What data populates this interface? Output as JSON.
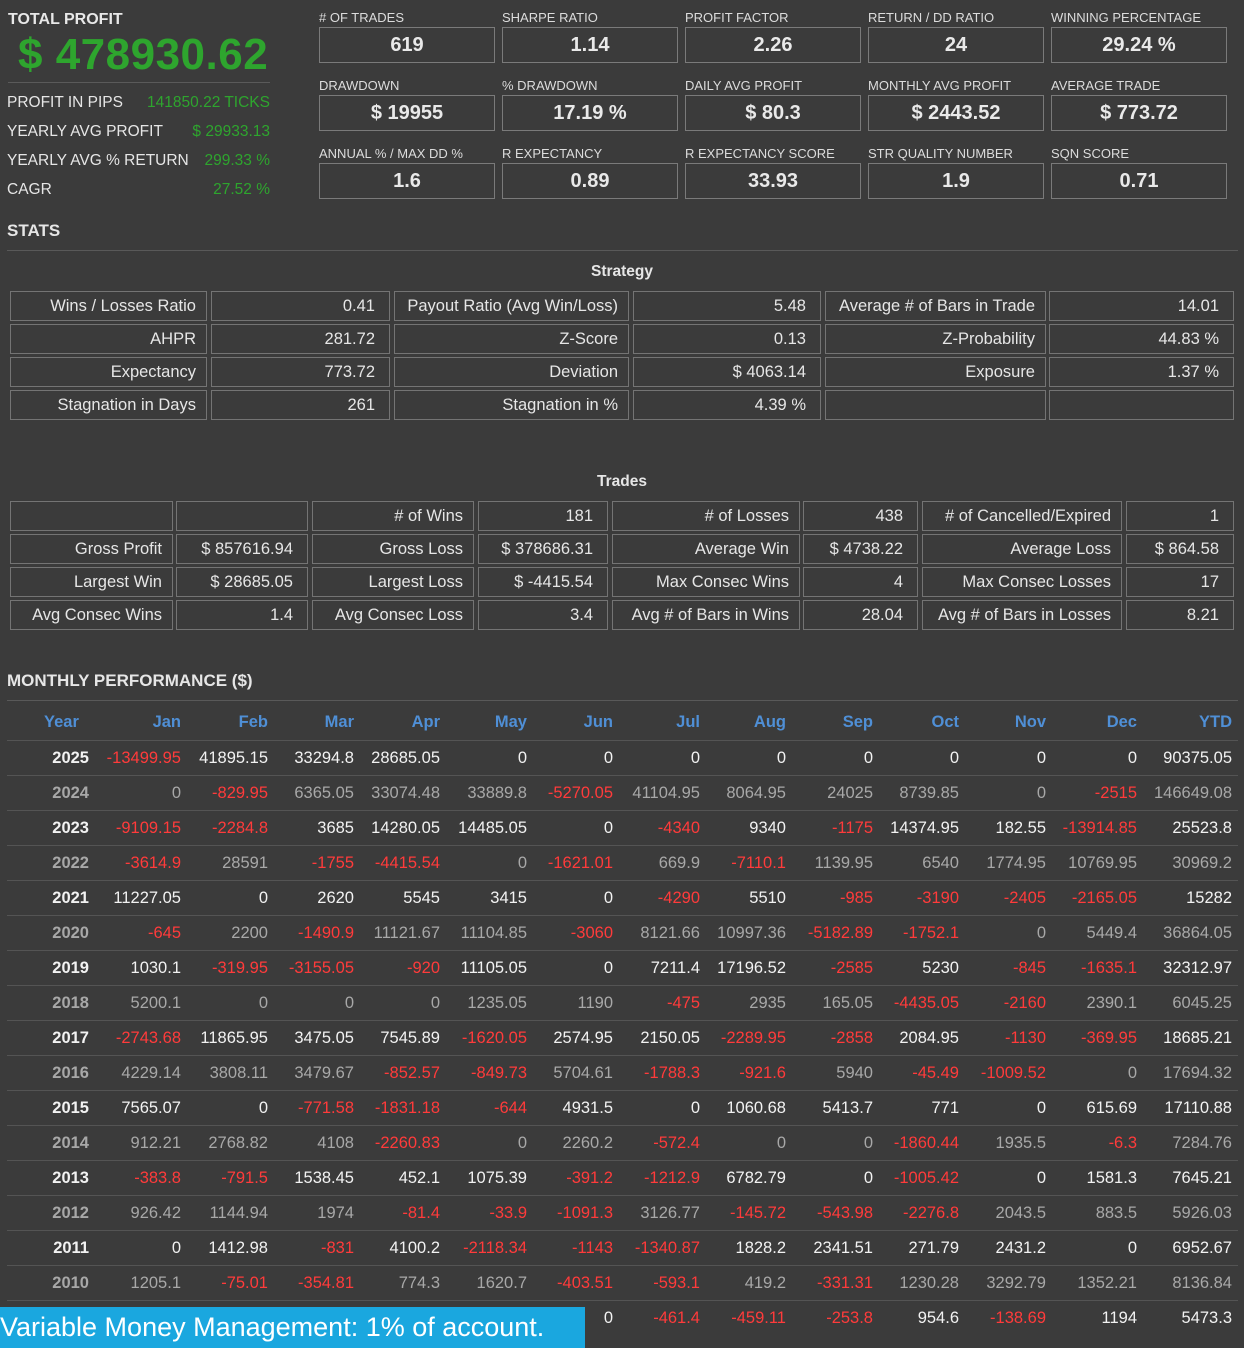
{
  "summary": {
    "total_profit_label": "TOTAL PROFIT",
    "total_profit_value": "$ 478930.62",
    "rows": [
      {
        "label": "PROFIT IN PIPS",
        "value": "141850.22 TICKS"
      },
      {
        "label": "YEARLY AVG PROFIT",
        "value": "$ 29933.13"
      },
      {
        "label": "YEARLY AVG % RETURN",
        "value": "299.33 %"
      },
      {
        "label": "CAGR",
        "value": "27.52 %"
      }
    ]
  },
  "metrics": [
    {
      "label": "# OF TRADES",
      "value": "619"
    },
    {
      "label": "SHARPE RATIO",
      "value": "1.14"
    },
    {
      "label": "PROFIT FACTOR",
      "value": "2.26"
    },
    {
      "label": "RETURN / DD RATIO",
      "value": "24"
    },
    {
      "label": "WINNING PERCENTAGE",
      "value": "29.24 %"
    },
    {
      "label": "DRAWDOWN",
      "value": "$ 19955"
    },
    {
      "label": "% DRAWDOWN",
      "value": "17.19 %"
    },
    {
      "label": "DAILY AVG PROFIT",
      "value": "$ 80.3"
    },
    {
      "label": "MONTHLY AVG PROFIT",
      "value": "$ 2443.52"
    },
    {
      "label": "AVERAGE TRADE",
      "value": "$ 773.72"
    },
    {
      "label": "ANNUAL % / MAX DD %",
      "value": "1.6"
    },
    {
      "label": "R EXPECTANCY",
      "value": "0.89"
    },
    {
      "label": "R EXPECTANCY SCORE",
      "value": "33.93"
    },
    {
      "label": "STR QUALITY NUMBER",
      "value": "1.9"
    },
    {
      "label": "SQN SCORE",
      "value": "0.71"
    }
  ],
  "stats": {
    "title": "STATS",
    "strategy": {
      "title": "Strategy",
      "rows": [
        [
          "Wins / Losses Ratio",
          "0.41",
          "Payout Ratio (Avg Win/Loss)",
          "5.48",
          "Average # of Bars in Trade",
          "14.01"
        ],
        [
          "AHPR",
          "281.72",
          "Z-Score",
          "0.13",
          "Z-Probability",
          "44.83 %"
        ],
        [
          "Expectancy",
          "773.72",
          "Deviation",
          "$ 4063.14",
          "Exposure",
          "1.37 %"
        ],
        [
          "Stagnation in Days",
          "261",
          "Stagnation in %",
          "4.39 %",
          "",
          ""
        ]
      ]
    },
    "trades": {
      "title": "Trades",
      "rows": [
        [
          "",
          "",
          "# of Wins",
          "181",
          "# of Losses",
          "438",
          "# of Cancelled/Expired",
          "1"
        ],
        [
          "Gross Profit",
          "$ 857616.94",
          "Gross Loss",
          "$ 378686.31",
          "Average Win",
          "$ 4738.22",
          "Average Loss",
          "$ 864.58"
        ],
        [
          "Largest Win",
          "$ 28685.05",
          "Largest Loss",
          "$ -4415.54",
          "Max Consec Wins",
          "4",
          "Max Consec Losses",
          "17"
        ],
        [
          "Avg Consec Wins",
          "1.4",
          "Avg Consec Loss",
          "3.4",
          "Avg # of Bars in Wins",
          "28.04",
          "Avg # of Bars in Losses",
          "8.21"
        ]
      ]
    }
  },
  "monthly": {
    "title": "MONTHLY PERFORMANCE ($)",
    "headers": [
      "Year",
      "Jan",
      "Feb",
      "Mar",
      "Apr",
      "May",
      "Jun",
      "Jul",
      "Aug",
      "Sep",
      "Oct",
      "Nov",
      "Dec",
      "YTD"
    ],
    "rows": [
      [
        "2025",
        "-13499.95",
        "41895.15",
        "33294.8",
        "28685.05",
        "0",
        "0",
        "0",
        "0",
        "0",
        "0",
        "0",
        "0",
        "90375.05"
      ],
      [
        "2024",
        "0",
        "-829.95",
        "6365.05",
        "33074.48",
        "33889.8",
        "-5270.05",
        "41104.95",
        "8064.95",
        "24025",
        "8739.85",
        "0",
        "-2515",
        "146649.08"
      ],
      [
        "2023",
        "-9109.15",
        "-2284.8",
        "3685",
        "14280.05",
        "14485.05",
        "0",
        "-4340",
        "9340",
        "-1175",
        "14374.95",
        "182.55",
        "-13914.85",
        "25523.8"
      ],
      [
        "2022",
        "-3614.9",
        "28591",
        "-1755",
        "-4415.54",
        "0",
        "-1621.01",
        "669.9",
        "-7110.1",
        "1139.95",
        "6540",
        "1774.95",
        "10769.95",
        "30969.2"
      ],
      [
        "2021",
        "11227.05",
        "0",
        "2620",
        "5545",
        "3415",
        "0",
        "-4290",
        "5510",
        "-985",
        "-3190",
        "-2405",
        "-2165.05",
        "15282"
      ],
      [
        "2020",
        "-645",
        "2200",
        "-1490.9",
        "11121.67",
        "11104.85",
        "-3060",
        "8121.66",
        "10997.36",
        "-5182.89",
        "-1752.1",
        "0",
        "5449.4",
        "36864.05"
      ],
      [
        "2019",
        "1030.1",
        "-319.95",
        "-3155.05",
        "-920",
        "11105.05",
        "0",
        "7211.4",
        "17196.52",
        "-2585",
        "5230",
        "-845",
        "-1635.1",
        "32312.97"
      ],
      [
        "2018",
        "5200.1",
        "0",
        "0",
        "0",
        "1235.05",
        "1190",
        "-475",
        "2935",
        "165.05",
        "-4435.05",
        "-2160",
        "2390.1",
        "6045.25"
      ],
      [
        "2017",
        "-2743.68",
        "11865.95",
        "3475.05",
        "7545.89",
        "-1620.05",
        "2574.95",
        "2150.05",
        "-2289.95",
        "-2858",
        "2084.95",
        "-1130",
        "-369.95",
        "18685.21"
      ],
      [
        "2016",
        "4229.14",
        "3808.11",
        "3479.67",
        "-852.57",
        "-849.73",
        "5704.61",
        "-1788.3",
        "-921.6",
        "5940",
        "-45.49",
        "-1009.52",
        "0",
        "17694.32"
      ],
      [
        "2015",
        "7565.07",
        "0",
        "-771.58",
        "-1831.18",
        "-644",
        "4931.5",
        "0",
        "1060.68",
        "5413.7",
        "771",
        "0",
        "615.69",
        "17110.88"
      ],
      [
        "2014",
        "912.21",
        "2768.82",
        "4108",
        "-2260.83",
        "0",
        "2260.2",
        "-572.4",
        "0",
        "0",
        "-1860.44",
        "1935.5",
        "-6.3",
        "7284.76"
      ],
      [
        "2013",
        "-383.8",
        "-791.5",
        "1538.45",
        "452.1",
        "1075.39",
        "-391.2",
        "-1212.9",
        "6782.79",
        "0",
        "-1005.42",
        "0",
        "1581.3",
        "7645.21"
      ],
      [
        "2012",
        "926.42",
        "1144.94",
        "1974",
        "-81.4",
        "-33.9",
        "-1091.3",
        "3126.77",
        "-145.72",
        "-543.98",
        "-2276.8",
        "2043.5",
        "883.5",
        "5926.03"
      ],
      [
        "2011",
        "0",
        "1412.98",
        "-831",
        "4100.2",
        "-2118.34",
        "-1143",
        "-1340.87",
        "1828.2",
        "2341.51",
        "271.79",
        "2431.2",
        "0",
        "6952.67"
      ],
      [
        "2010",
        "1205.1",
        "-75.01",
        "-354.81",
        "774.3",
        "1620.7",
        "-403.51",
        "-593.1",
        "419.2",
        "-331.31",
        "1230.28",
        "3292.79",
        "1352.21",
        "8136.84"
      ],
      [
        "",
        "",
        "",
        "",
        "",
        "",
        "0",
        "-461.4",
        "-459.11",
        "-253.8",
        "954.6",
        "-138.69",
        "1194",
        "5473.3"
      ]
    ]
  },
  "footer_banner": "Variable Money Management: 1% of account.",
  "colors": {
    "background": "#3b3b3b",
    "positive_green": "#2ea52e",
    "negative_red": "#ff3b3b",
    "header_blue": "#4f8fd6",
    "banner_blue": "#1aa7df"
  }
}
